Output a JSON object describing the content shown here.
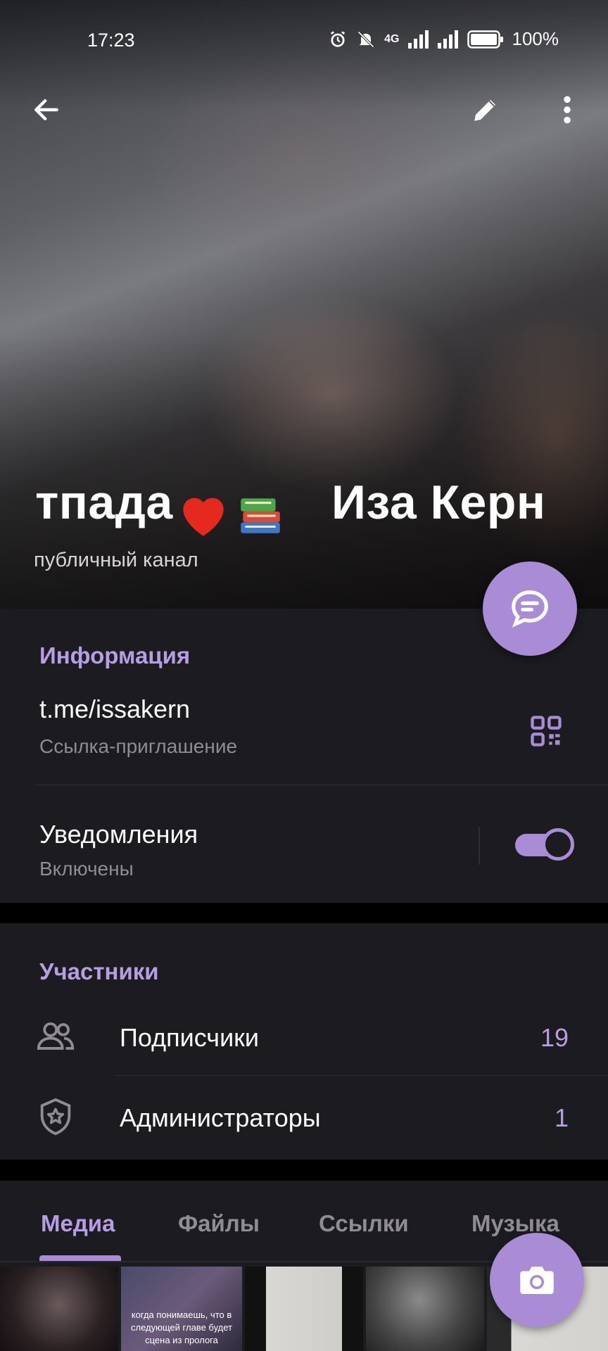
{
  "status_bar": {
    "time": "17:23",
    "network": "4G",
    "battery": "100%"
  },
  "header": {
    "back_icon": "arrow-left-icon",
    "edit_icon": "pencil-icon",
    "more_icon": "more-vertical-icon",
    "title_part1": "тпада",
    "title_emoji": "heart-and-books",
    "title_part2": "Иза Керн",
    "subtitle": "публичный канал"
  },
  "info": {
    "heading": "Информация",
    "link": "t.me/issakern",
    "link_caption": "Ссылка-приглашение",
    "notifications_label": "Уведомления",
    "notifications_state": "Включены",
    "notifications_on": true
  },
  "members": {
    "heading": "Участники",
    "items": [
      {
        "label": "Подписчики",
        "count": "19",
        "icon": "people-icon"
      },
      {
        "label": "Администраторы",
        "count": "1",
        "icon": "shield-star-icon"
      }
    ]
  },
  "media": {
    "tabs": [
      {
        "label": "Медиа",
        "active": true
      },
      {
        "label": "Файлы",
        "active": false
      },
      {
        "label": "Ссылки",
        "active": false
      },
      {
        "label": "Музыка",
        "active": false
      }
    ],
    "thumb_caption": "когда понимаешь, что в следующей главе будет сцена из пролога"
  },
  "colors": {
    "accent": "#a98bd6",
    "accent_text": "#b79de3",
    "surface": "#1c1b1f",
    "background": "#000000"
  }
}
